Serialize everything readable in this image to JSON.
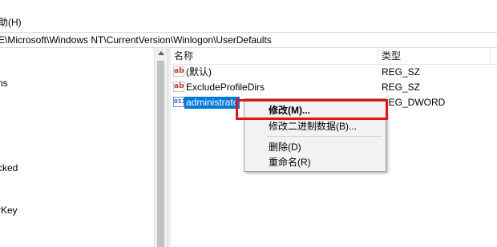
{
  "menubar": {
    "help_label": "助(H)"
  },
  "address": {
    "path": "E\\Microsoft\\Windows NT\\CurrentVersion\\Winlogon\\UserDefaults"
  },
  "tree": {
    "items": [
      {
        "label": "ns"
      },
      {
        "label": "cked"
      },
      {
        "label": "rKey"
      }
    ]
  },
  "list": {
    "headers": {
      "name": "名称",
      "type": "类型"
    },
    "rows": [
      {
        "icon": "string-value-icon",
        "icon_glyph": "ab",
        "name": "(默认)",
        "type": "REG_SZ"
      },
      {
        "icon": "string-value-icon",
        "icon_glyph": "ab",
        "name": "ExcludeProfileDirs",
        "type": "REG_SZ"
      },
      {
        "icon": "dword-value-icon",
        "icon_glyph": "011",
        "name": "administrato",
        "type": "REG_DWORD"
      }
    ]
  },
  "context_menu": {
    "items": [
      {
        "label": "修改(M)...",
        "bold": true
      },
      {
        "label": "修改二进制数据(B)..."
      },
      {
        "label": "删除(D)"
      },
      {
        "label": "重命名(R)"
      }
    ]
  },
  "colors": {
    "selection": "#0078d7",
    "highlight_box": "#e0151b"
  }
}
